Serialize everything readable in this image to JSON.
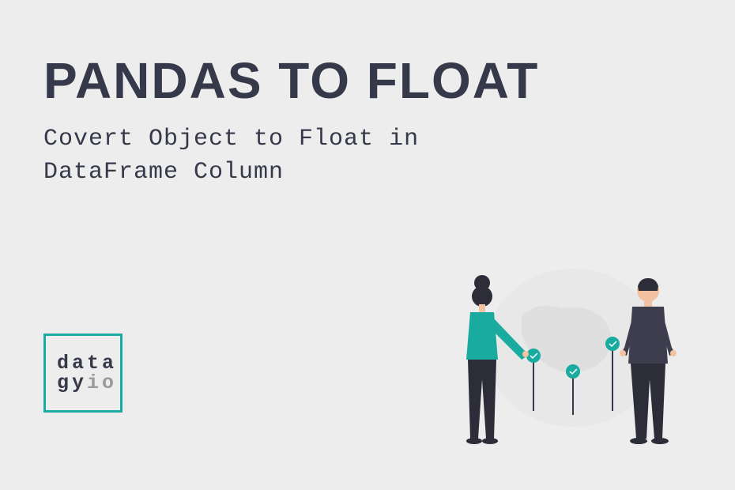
{
  "title": "PANDAS TO FLOAT",
  "subtitle_line1": "Covert Object to Float in",
  "subtitle_line2": "DataFrame Column",
  "logo": {
    "line1": "data",
    "gy": "gy",
    "io": "io"
  }
}
